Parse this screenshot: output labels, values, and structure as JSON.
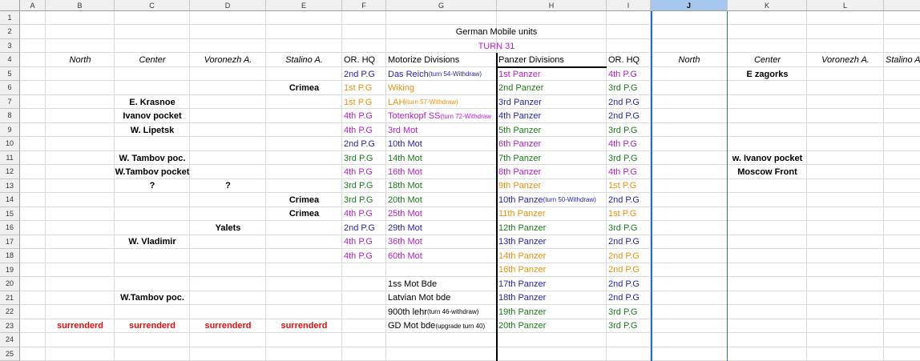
{
  "sheet": {
    "columns": [
      "A",
      "B",
      "C",
      "D",
      "E",
      "F",
      "G",
      "H",
      "I",
      "J",
      "K",
      "L"
    ],
    "selected_column": "J",
    "rows": [
      "1",
      "2",
      "3",
      "4",
      "5",
      "6",
      "7",
      "8",
      "9",
      "10",
      "11",
      "12",
      "13",
      "14",
      "15",
      "16",
      "17",
      "18",
      "19",
      "20",
      "21",
      "22",
      "23",
      "24",
      "25"
    ]
  },
  "colors": {
    "blue": "#1f1fb4",
    "orange": "#e8900c",
    "purple": "#b21fc8",
    "green": "#1a7a1a",
    "red": "#e01010",
    "black": "#000000"
  },
  "cells": [
    {
      "row": 2,
      "col": "G",
      "span": 2,
      "text": "German Mobile units",
      "color": "black",
      "align": "c"
    },
    {
      "row": 3,
      "col": "G",
      "span": 2,
      "text": "TURN 31",
      "color": "purple",
      "align": "c"
    },
    {
      "row": 4,
      "col": "B",
      "text": "North",
      "italic": true,
      "align": "c"
    },
    {
      "row": 4,
      "col": "C",
      "text": "Center",
      "italic": true,
      "align": "c"
    },
    {
      "row": 4,
      "col": "D",
      "text": "Voronezh A.",
      "italic": true,
      "align": "c"
    },
    {
      "row": 4,
      "col": "E",
      "text": "Stalino A.",
      "italic": true,
      "align": "c"
    },
    {
      "row": 4,
      "col": "F",
      "text": "OR. HQ"
    },
    {
      "row": 4,
      "col": "G",
      "text": "Motorize Divisions"
    },
    {
      "row": 4,
      "col": "H",
      "text": "Panzer Divisions"
    },
    {
      "row": 4,
      "col": "I",
      "text": "OR. HQ"
    },
    {
      "row": 4,
      "col": "J",
      "text": "North",
      "italic": true,
      "align": "c"
    },
    {
      "row": 4,
      "col": "K",
      "text": "Center",
      "italic": true,
      "align": "c"
    },
    {
      "row": 4,
      "col": "L",
      "text": "Voronezh A.",
      "italic": true,
      "align": "c"
    },
    {
      "row": 4,
      "col": "M",
      "text": "Stalino A.",
      "italic": true
    },
    {
      "row": 5,
      "col": "F",
      "text": "2nd P.G",
      "color": "blue"
    },
    {
      "row": 5,
      "col": "G",
      "text": "Das Reich",
      "small": "(turn 54-Withdraw)",
      "color": "blue"
    },
    {
      "row": 5,
      "col": "H",
      "text": "1st Panzer",
      "color": "purple"
    },
    {
      "row": 5,
      "col": "I",
      "text": "4th P.G",
      "color": "purple"
    },
    {
      "row": 5,
      "col": "K",
      "text": "E zagorks",
      "bold": true,
      "align": "c"
    },
    {
      "row": 6,
      "col": "E",
      "text": "Crimea",
      "bold": true,
      "align": "c"
    },
    {
      "row": 6,
      "col": "F",
      "text": "1st P.G",
      "color": "orange"
    },
    {
      "row": 6,
      "col": "G",
      "text": "Wiking",
      "color": "orange"
    },
    {
      "row": 6,
      "col": "H",
      "text": "2nd Panzer",
      "color": "green"
    },
    {
      "row": 6,
      "col": "I",
      "text": "3rd P.G",
      "color": "green"
    },
    {
      "row": 7,
      "col": "C",
      "text": "E. Krasnoe",
      "bold": true,
      "align": "c"
    },
    {
      "row": 7,
      "col": "F",
      "text": "1st P.G",
      "color": "orange"
    },
    {
      "row": 7,
      "col": "G",
      "text": "LAH",
      "small": "(turn 57-Withdraw)",
      "color": "orange"
    },
    {
      "row": 7,
      "col": "H",
      "text": "3rd Panzer",
      "color": "blue"
    },
    {
      "row": 7,
      "col": "I",
      "text": "2nd P.G",
      "color": "blue"
    },
    {
      "row": 8,
      "col": "C",
      "text": "Ivanov pocket",
      "bold": true,
      "align": "c"
    },
    {
      "row": 8,
      "col": "F",
      "text": "4th P.G",
      "color": "purple"
    },
    {
      "row": 8,
      "col": "G",
      "text": "Totenkopf SS",
      "small": "(turn 72-Withdraw",
      "color": "purple"
    },
    {
      "row": 8,
      "col": "H",
      "text": "4th Panzer",
      "color": "blue"
    },
    {
      "row": 8,
      "col": "I",
      "text": "2nd P.G",
      "color": "blue"
    },
    {
      "row": 9,
      "col": "C",
      "text": "W. Lipetsk",
      "bold": true,
      "align": "c"
    },
    {
      "row": 9,
      "col": "F",
      "text": "4th P.G",
      "color": "purple"
    },
    {
      "row": 9,
      "col": "G",
      "text": "3rd Mot",
      "color": "purple"
    },
    {
      "row": 9,
      "col": "H",
      "text": "5th Panzer",
      "color": "green"
    },
    {
      "row": 9,
      "col": "I",
      "text": "3rd P.G",
      "color": "green"
    },
    {
      "row": 10,
      "col": "F",
      "text": "2nd P.G",
      "color": "blue"
    },
    {
      "row": 10,
      "col": "G",
      "text": "10th Mot",
      "color": "blue"
    },
    {
      "row": 10,
      "col": "H",
      "text": "6th Panzer",
      "color": "purple"
    },
    {
      "row": 10,
      "col": "I",
      "text": "4th P.G",
      "color": "purple"
    },
    {
      "row": 11,
      "col": "C",
      "text": "W. Tambov poc.",
      "bold": true,
      "align": "c"
    },
    {
      "row": 11,
      "col": "F",
      "text": "3rd P.G",
      "color": "green"
    },
    {
      "row": 11,
      "col": "G",
      "text": "14th Mot",
      "color": "green"
    },
    {
      "row": 11,
      "col": "H",
      "text": "7th Panzer",
      "color": "green"
    },
    {
      "row": 11,
      "col": "I",
      "text": "3rd P.G",
      "color": "green"
    },
    {
      "row": 11,
      "col": "K",
      "text": "w. Ivanov pocket",
      "bold": true,
      "align": "c"
    },
    {
      "row": 12,
      "col": "C",
      "text": "W.Tambov pocket",
      "bold": true,
      "align": "c"
    },
    {
      "row": 12,
      "col": "F",
      "text": "4th P.G",
      "color": "purple"
    },
    {
      "row": 12,
      "col": "G",
      "text": "16th Mot",
      "color": "purple"
    },
    {
      "row": 12,
      "col": "H",
      "text": "8th Panzer",
      "color": "purple"
    },
    {
      "row": 12,
      "col": "I",
      "text": "4th P.G",
      "color": "purple"
    },
    {
      "row": 12,
      "col": "K",
      "text": "Moscow Front",
      "bold": true,
      "align": "c"
    },
    {
      "row": 13,
      "col": "C",
      "text": "?",
      "bold": true,
      "align": "c"
    },
    {
      "row": 13,
      "col": "D",
      "text": "?",
      "bold": true,
      "align": "c"
    },
    {
      "row": 13,
      "col": "F",
      "text": "3rd P.G",
      "color": "green"
    },
    {
      "row": 13,
      "col": "G",
      "text": "18th Mot",
      "color": "green"
    },
    {
      "row": 13,
      "col": "H",
      "text": "9th Panzer",
      "color": "orange"
    },
    {
      "row": 13,
      "col": "I",
      "text": "1st P.G",
      "color": "orange"
    },
    {
      "row": 14,
      "col": "E",
      "text": "Crimea",
      "bold": true,
      "align": "c"
    },
    {
      "row": 14,
      "col": "F",
      "text": "3rd P.G",
      "color": "green"
    },
    {
      "row": 14,
      "col": "G",
      "text": "20th Mot",
      "color": "green"
    },
    {
      "row": 14,
      "col": "H",
      "text": "10th Panze",
      "small": "(turn 50-Withdraw)",
      "color": "blue"
    },
    {
      "row": 14,
      "col": "I",
      "text": "2nd P.G",
      "color": "blue"
    },
    {
      "row": 15,
      "col": "E",
      "text": "Crimea",
      "bold": true,
      "align": "c"
    },
    {
      "row": 15,
      "col": "F",
      "text": "4th P.G",
      "color": "purple"
    },
    {
      "row": 15,
      "col": "G",
      "text": "25th Mot",
      "color": "purple"
    },
    {
      "row": 15,
      "col": "H",
      "text": "11th Panzer",
      "color": "orange"
    },
    {
      "row": 15,
      "col": "I",
      "text": "1st P.G",
      "color": "orange"
    },
    {
      "row": 16,
      "col": "D",
      "text": "Yalets",
      "bold": true,
      "align": "c"
    },
    {
      "row": 16,
      "col": "F",
      "text": "2nd P.G",
      "color": "blue"
    },
    {
      "row": 16,
      "col": "G",
      "text": "29th Mot",
      "color": "blue"
    },
    {
      "row": 16,
      "col": "H",
      "text": "12th Panzer",
      "color": "green"
    },
    {
      "row": 16,
      "col": "I",
      "text": "3rd P.G",
      "color": "green"
    },
    {
      "row": 17,
      "col": "C",
      "text": "W. Vladimir",
      "bold": true,
      "align": "c"
    },
    {
      "row": 17,
      "col": "F",
      "text": "4th P.G",
      "color": "purple"
    },
    {
      "row": 17,
      "col": "G",
      "text": "36th Mot",
      "color": "purple"
    },
    {
      "row": 17,
      "col": "H",
      "text": "13th Panzer",
      "color": "blue"
    },
    {
      "row": 17,
      "col": "I",
      "text": "2nd P.G",
      "color": "blue"
    },
    {
      "row": 18,
      "col": "F",
      "text": "4th P.G",
      "color": "purple"
    },
    {
      "row": 18,
      "col": "G",
      "text": "60th Mot",
      "color": "purple"
    },
    {
      "row": 18,
      "col": "H",
      "text": "14th Panzer",
      "color": "orange"
    },
    {
      "row": 18,
      "col": "I",
      "text": "2nd P.G",
      "color": "orange"
    },
    {
      "row": 19,
      "col": "H",
      "text": "16th Panzer",
      "color": "orange"
    },
    {
      "row": 19,
      "col": "I",
      "text": "2nd P.G",
      "color": "orange"
    },
    {
      "row": 20,
      "col": "G",
      "text": "1ss Mot Bde",
      "color": "black"
    },
    {
      "row": 20,
      "col": "H",
      "text": "17th Panzer",
      "color": "blue"
    },
    {
      "row": 20,
      "col": "I",
      "text": "2nd P.G",
      "color": "blue"
    },
    {
      "row": 21,
      "col": "C",
      "text": "W.Tambov poc.",
      "bold": true,
      "align": "c"
    },
    {
      "row": 21,
      "col": "G",
      "text": "Latvian Mot bde",
      "color": "black"
    },
    {
      "row": 21,
      "col": "H",
      "text": "18th Panzer",
      "color": "blue"
    },
    {
      "row": 21,
      "col": "I",
      "text": "2nd P.G",
      "color": "blue"
    },
    {
      "row": 22,
      "col": "G",
      "text": "900th lehr ",
      "small": "(turn 46-withdraw)",
      "color": "black"
    },
    {
      "row": 22,
      "col": "H",
      "text": "19th Panzer",
      "color": "green"
    },
    {
      "row": 22,
      "col": "I",
      "text": "3rd P.G",
      "color": "green"
    },
    {
      "row": 23,
      "col": "B",
      "text": "surrenderd",
      "bold": true,
      "color": "red",
      "align": "c"
    },
    {
      "row": 23,
      "col": "C",
      "text": "surrenderd",
      "bold": true,
      "color": "red",
      "align": "c"
    },
    {
      "row": 23,
      "col": "D",
      "text": "surrenderd",
      "bold": true,
      "color": "red",
      "align": "c"
    },
    {
      "row": 23,
      "col": "E",
      "text": "surrenderd",
      "bold": true,
      "color": "red",
      "align": "c"
    },
    {
      "row": 23,
      "col": "G",
      "text": "GD Mot bde",
      "small": "(upgrade turn 40)",
      "color": "black"
    },
    {
      "row": 23,
      "col": "H",
      "text": "20th Panzer",
      "color": "green"
    },
    {
      "row": 23,
      "col": "I",
      "text": "3rd P.G",
      "color": "green"
    }
  ],
  "m_column_header": "Stali"
}
